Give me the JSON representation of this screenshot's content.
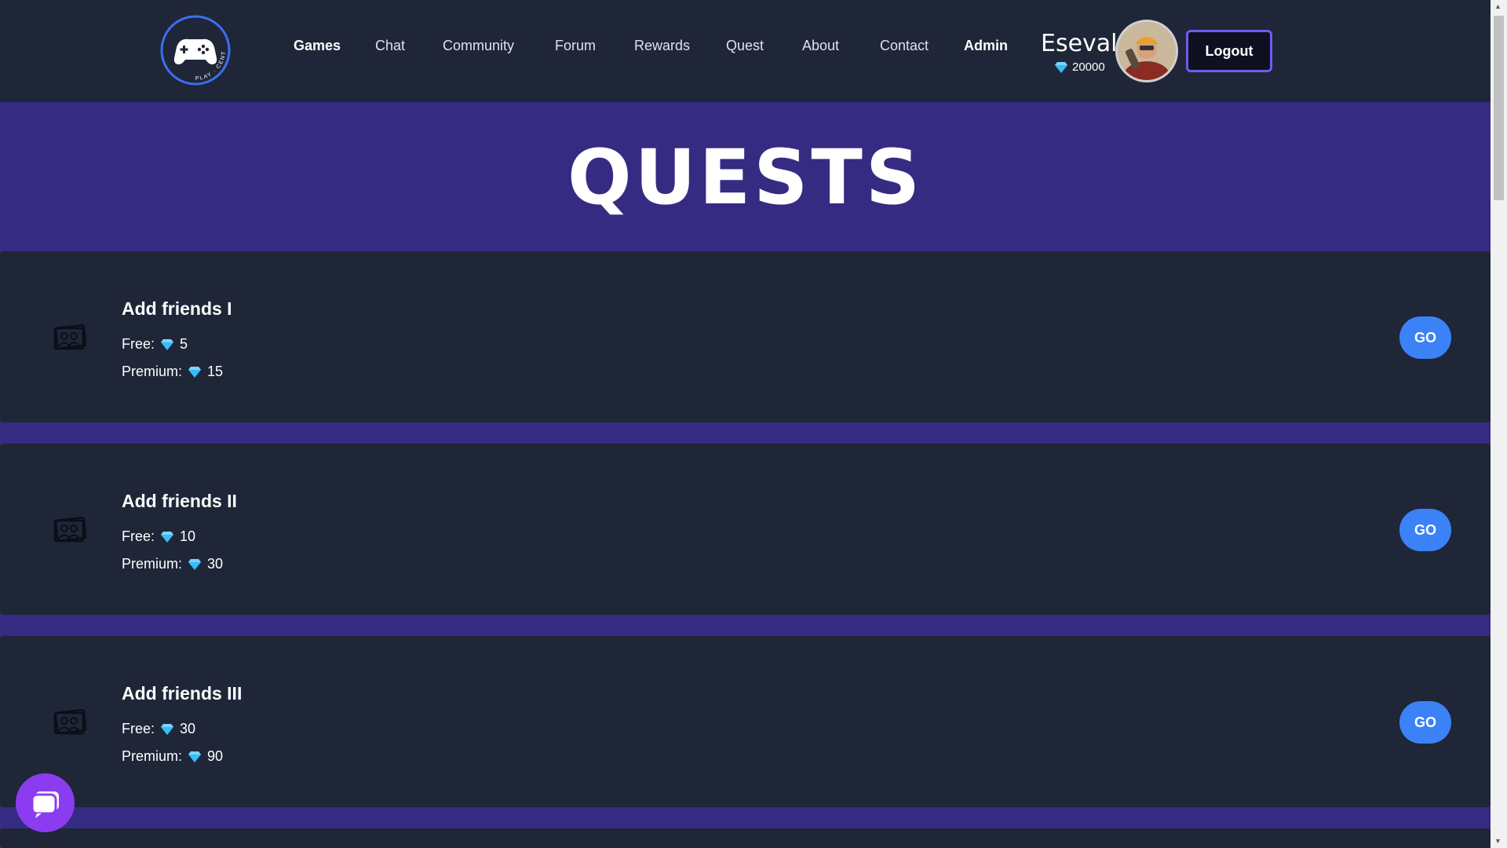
{
  "nav": {
    "items": [
      {
        "label": "Games",
        "active": true
      },
      {
        "label": "Chat",
        "active": false
      },
      {
        "label": "Community",
        "active": false
      },
      {
        "label": "Forum",
        "active": false
      },
      {
        "label": "Rewards",
        "active": false
      },
      {
        "label": "Quest",
        "active": false
      },
      {
        "label": "About",
        "active": false
      },
      {
        "label": "Contact",
        "active": false
      },
      {
        "label": "Admin",
        "active": false
      }
    ]
  },
  "logo": {
    "text": "PLAY · CENTER"
  },
  "user": {
    "name": "Eseval",
    "gems": "20000",
    "logout_label": "Logout"
  },
  "hero": {
    "title": "QUESTS"
  },
  "quests": [
    {
      "title": "Add friends I",
      "free_label": "Free:",
      "free_value": "5",
      "premium_label": "Premium:",
      "premium_value": "15",
      "go_label": "GO"
    },
    {
      "title": "Add friends II",
      "free_label": "Free:",
      "free_value": "10",
      "premium_label": "Premium:",
      "premium_value": "30",
      "go_label": "GO"
    },
    {
      "title": "Add friends III",
      "free_label": "Free:",
      "free_value": "30",
      "premium_label": "Premium:",
      "premium_value": "90",
      "go_label": "GO"
    }
  ],
  "colors": {
    "background": "#352b82",
    "card": "#1f2638",
    "accent_blue": "#3b82f6",
    "chat_purple": "#8b3cf0",
    "logout_border": "#6c5cf0"
  }
}
